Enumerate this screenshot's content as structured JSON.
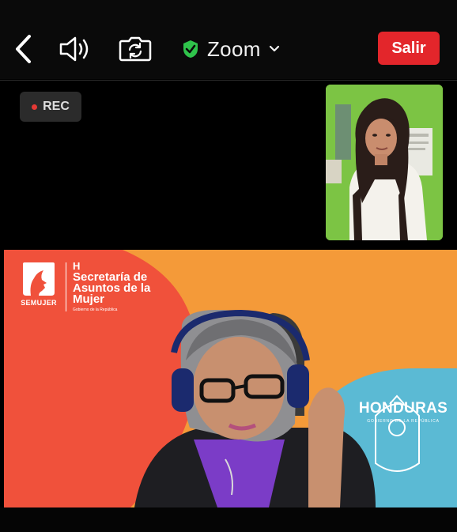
{
  "toolbar": {
    "back_icon": "chevron-left-icon",
    "audio_icon": "speaker-icon",
    "camera_icon": "camera-switch-icon",
    "meeting_title": "Zoom",
    "leave_label": "Salir",
    "accent": "#e3262b",
    "secure_color": "#2fc34b"
  },
  "recording": {
    "label": "REC"
  },
  "main_video": {
    "org_logo_text": "SEMUJER",
    "org_prefix": "H",
    "org_name": "Secretaría de Asuntos de la Mujer",
    "org_subtext": "Gobierno de la República",
    "country_name": "HONDURAS",
    "country_subtext": "GOBIERNO DE LA REPÚBLICA",
    "colors": {
      "red": "#f0513b",
      "orange": "#f49a39",
      "teal": "#5bbad4"
    }
  }
}
